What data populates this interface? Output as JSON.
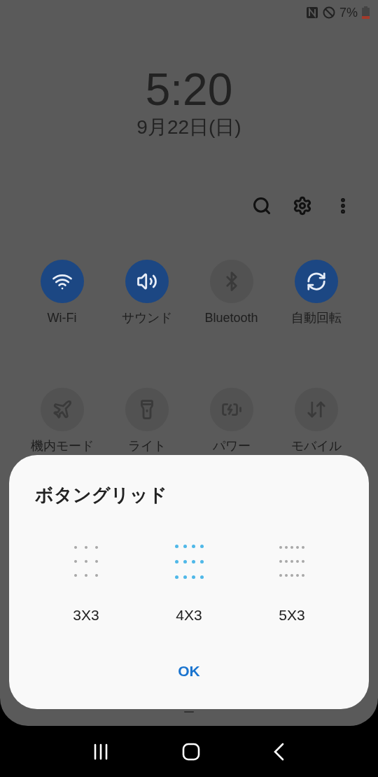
{
  "status_bar": {
    "battery": "7%"
  },
  "lock": {
    "time": "5:20",
    "date": "9月22日(日)"
  },
  "quick_tiles": [
    {
      "kind": "wifi",
      "label": "Wi-Fi",
      "on": true
    },
    {
      "kind": "sound",
      "label": "サウンド",
      "on": true
    },
    {
      "kind": "bluetooth",
      "label": "Bluetooth",
      "on": false
    },
    {
      "kind": "rotate",
      "label": "自動回転",
      "on": true
    },
    {
      "kind": "airplane",
      "label": "機内モード",
      "on": false
    },
    {
      "kind": "flashlight",
      "label": "ライト",
      "on": false
    },
    {
      "kind": "power",
      "label": "パワー",
      "on": false
    },
    {
      "kind": "data",
      "label": "モバイル",
      "on": false
    }
  ],
  "dialog": {
    "title": "ボタングリッド",
    "options": [
      {
        "label": "3X3",
        "selected": false
      },
      {
        "label": "4X3",
        "selected": true
      },
      {
        "label": "5X3",
        "selected": false
      }
    ],
    "button": "OK"
  }
}
